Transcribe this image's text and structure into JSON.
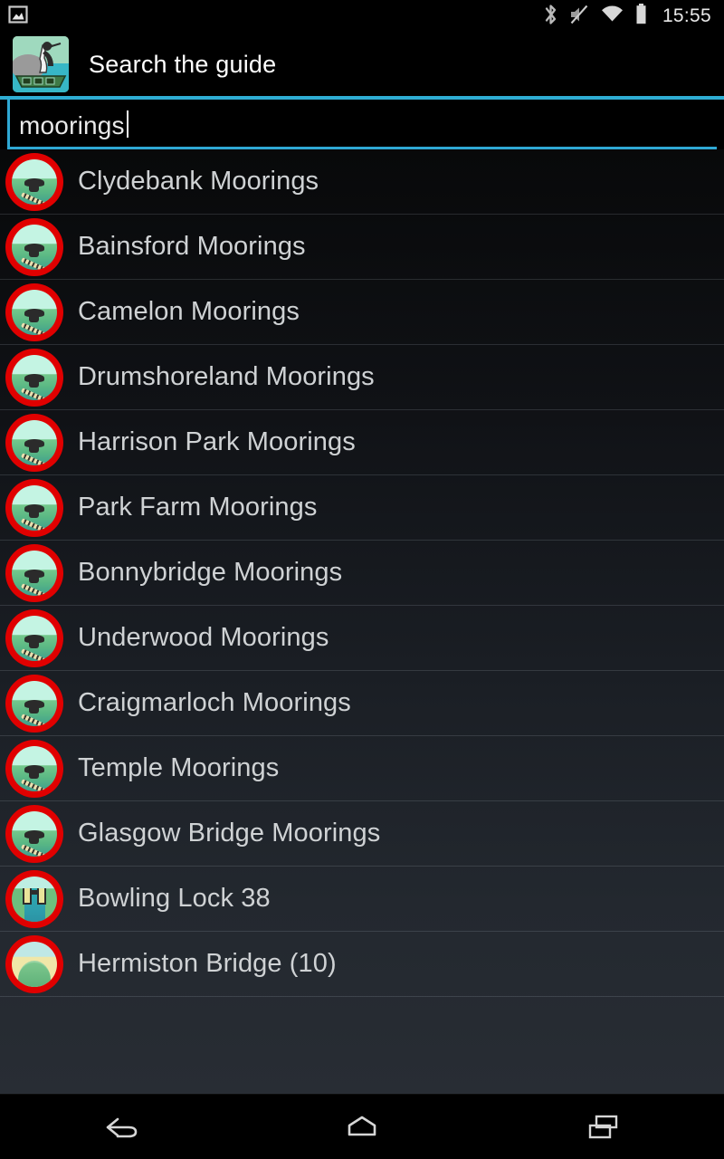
{
  "status_bar": {
    "left_icons": [
      {
        "name": "screenshot-notification-icon",
        "glyph": "image"
      }
    ],
    "right_icons": [
      {
        "name": "bluetooth-icon",
        "glyph": "bluetooth"
      },
      {
        "name": "volume-muted-icon",
        "glyph": "volume-mute"
      },
      {
        "name": "wifi-icon",
        "glyph": "wifi"
      },
      {
        "name": "battery-icon",
        "glyph": "battery-full"
      }
    ],
    "clock": "15:55"
  },
  "action_bar": {
    "title": "Search the guide",
    "app_icon_name": "heron-narrowboat-app-icon",
    "divider_color": "#2eadd3"
  },
  "search": {
    "value": "moorings",
    "placeholder": "Search the guide",
    "underline_color": "#2fa8d4"
  },
  "results": {
    "count": 13,
    "items": [
      {
        "label": "Clydebank Moorings",
        "icon": "mooring-marker-icon"
      },
      {
        "label": "Bainsford Moorings",
        "icon": "mooring-marker-icon"
      },
      {
        "label": "Camelon Moorings",
        "icon": "mooring-marker-icon"
      },
      {
        "label": "Drumshoreland Moorings",
        "icon": "mooring-marker-icon"
      },
      {
        "label": "Harrison Park Moorings",
        "icon": "mooring-marker-icon"
      },
      {
        "label": "Park Farm Moorings",
        "icon": "mooring-marker-icon"
      },
      {
        "label": "Bonnybridge Moorings",
        "icon": "mooring-marker-icon"
      },
      {
        "label": "Underwood Moorings",
        "icon": "mooring-marker-icon"
      },
      {
        "label": "Craigmarloch Moorings",
        "icon": "mooring-marker-icon"
      },
      {
        "label": "Temple Moorings",
        "icon": "mooring-marker-icon"
      },
      {
        "label": "Glasgow Bridge Moorings",
        "icon": "mooring-marker-icon"
      },
      {
        "label": "Bowling Lock 38",
        "icon": "lock-marker-icon"
      },
      {
        "label": "Hermiston Bridge (10)",
        "icon": "bridge-marker-icon"
      }
    ]
  },
  "nav_bar": {
    "back_label": "Back",
    "home_label": "Home",
    "recents_label": "Recent apps"
  },
  "colors": {
    "accent": "#2eadd3",
    "marker_ring": "#e00000",
    "text_primary": "#cfd2d4",
    "background_top": "#08090a",
    "background_bottom": "#282d34"
  }
}
